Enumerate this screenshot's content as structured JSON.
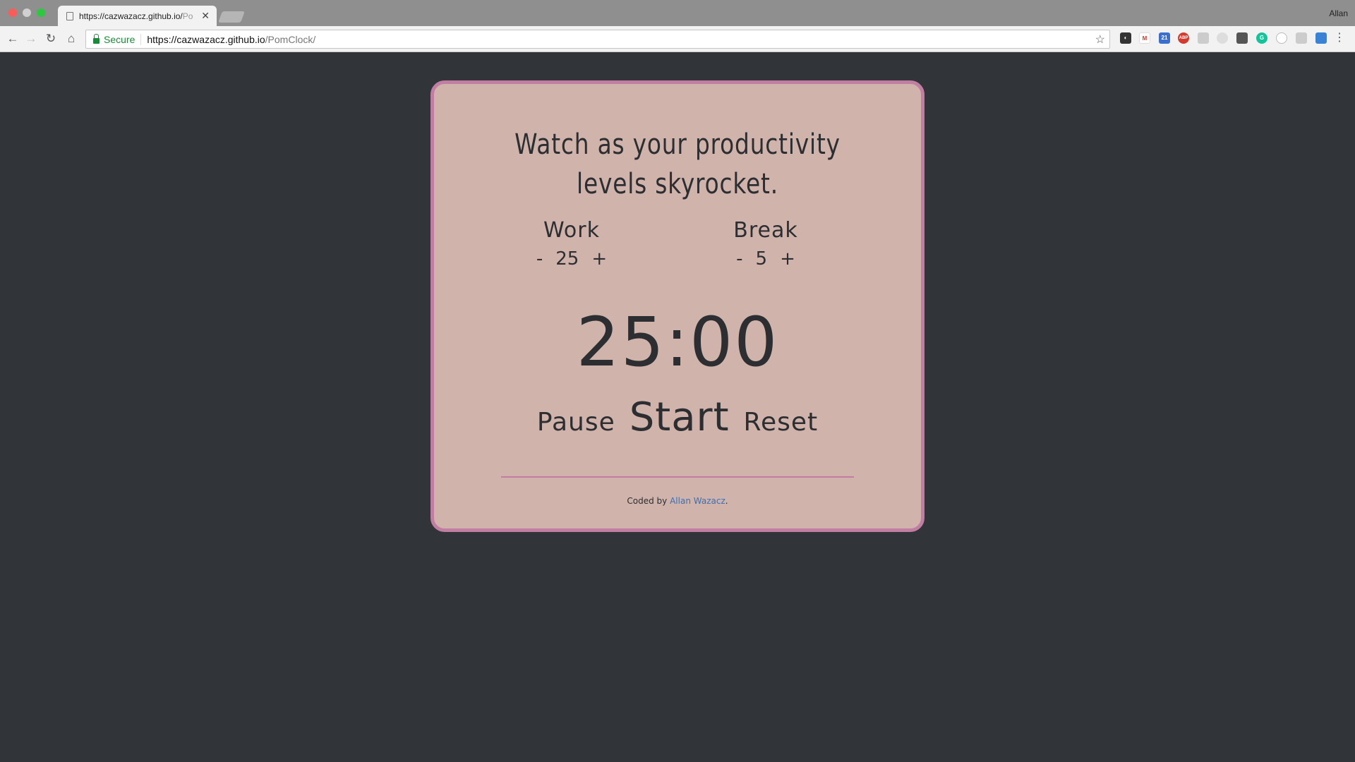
{
  "browser": {
    "tab_title_main": "https://cazwazacz.github.io/",
    "tab_title_fade": "Po",
    "profile_name": "Allan",
    "secure_label": "Secure",
    "url_host": "https://cazwazacz.github.io",
    "url_path": "/PomClock/",
    "extensions": [
      "dark-reader-icon",
      "gmail-icon",
      "calendar-icon",
      "adblock-plus-icon",
      "chat-icon",
      "reddit-icon",
      "lastpass-icon",
      "grammarly-icon",
      "circle-icon",
      "settings-icon",
      "screenshot-icon"
    ],
    "calendar_badge": "21",
    "adblock_badge": "ABP"
  },
  "app": {
    "tagline": "Watch as your productivity levels skyrocket.",
    "work": {
      "label": "Work",
      "minus": "-",
      "value": "25",
      "plus": "+"
    },
    "break": {
      "label": "Break",
      "minus": "-",
      "value": "5",
      "plus": "+"
    },
    "timer": "25:00",
    "controls": {
      "pause": "Pause",
      "start": "Start",
      "reset": "Reset"
    },
    "credit_prefix": "Coded by ",
    "credit_name": "Allan Wazacz",
    "credit_suffix": "."
  },
  "colors": {
    "page_bg": "#313438",
    "card_bg": "#d0b3ab",
    "card_border": "#c27ea2",
    "text": "#2d2e31",
    "link": "#3d6fb3"
  }
}
